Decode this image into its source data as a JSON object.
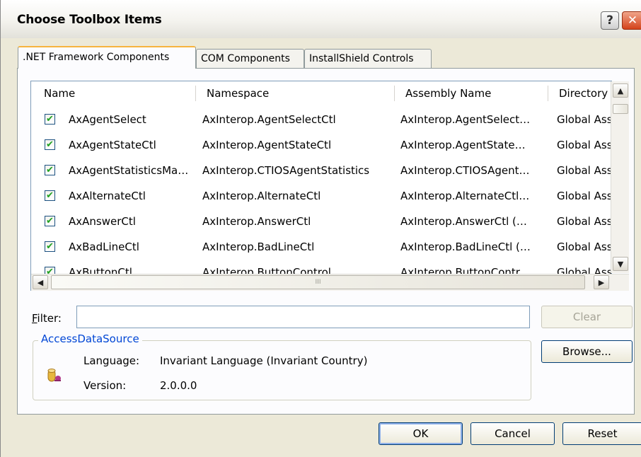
{
  "window": {
    "title": "Choose Toolbox Items",
    "help_glyph": "?",
    "close_glyph": "✕"
  },
  "tabs": [
    {
      "label": ".NET Framework Components",
      "active": true
    },
    {
      "label": "COM Components",
      "active": false
    },
    {
      "label": "InstallShield Controls",
      "active": false
    }
  ],
  "list": {
    "columns": [
      "Name",
      "Namespace",
      "Assembly Name",
      "Directory"
    ],
    "rows": [
      {
        "checked": true,
        "name": "AxAgentSelect",
        "namespace": "AxInterop.AgentSelectCtl",
        "assembly": "AxInterop.AgentSelect…",
        "directory": "Global Ass"
      },
      {
        "checked": true,
        "name": "AxAgentStateCtl",
        "namespace": "AxInterop.AgentStateCtl",
        "assembly": "AxInterop.AgentState…",
        "directory": "Global Ass"
      },
      {
        "checked": true,
        "name": "AxAgentStatisticsMa…",
        "namespace": "AxInterop.CTIOSAgentStatistics",
        "assembly": "AxInterop.CTIOSAgent…",
        "directory": "Global Ass"
      },
      {
        "checked": true,
        "name": "AxAlternateCtl",
        "namespace": "AxInterop.AlternateCtl",
        "assembly": "AxInterop.AlternateCtl…",
        "directory": "Global Ass"
      },
      {
        "checked": true,
        "name": "AxAnswerCtl",
        "namespace": "AxInterop.AnswerCtl",
        "assembly": "AxInterop.AnswerCtl (…",
        "directory": "Global Ass"
      },
      {
        "checked": true,
        "name": "AxBadLineCtl",
        "namespace": "AxInterop.BadLineCtl",
        "assembly": "AxInterop.BadLineCtl (…",
        "directory": "Global Ass"
      },
      {
        "checked": true,
        "name": "AxButtonCtl",
        "namespace": "AxInterop.ButtonControl",
        "assembly": "AxInterop.ButtonContr…",
        "directory": "Global Ass"
      }
    ]
  },
  "scrollbars": {
    "up_glyph": "▲",
    "down_glyph": "▼",
    "left_glyph": "◀",
    "right_glyph": "▶",
    "h_grip": "III"
  },
  "filter": {
    "label": "Filter:",
    "value": "",
    "clear_label": "Clear"
  },
  "details": {
    "component_name": "AccessDataSource",
    "language_label": "Language:",
    "language_value": "Invariant Language (Invariant Country)",
    "version_label": "Version:",
    "version_value": "2.0.0.0"
  },
  "buttons": {
    "browse": "Browse...",
    "ok": "OK",
    "cancel": "Cancel",
    "reset": "Reset"
  }
}
